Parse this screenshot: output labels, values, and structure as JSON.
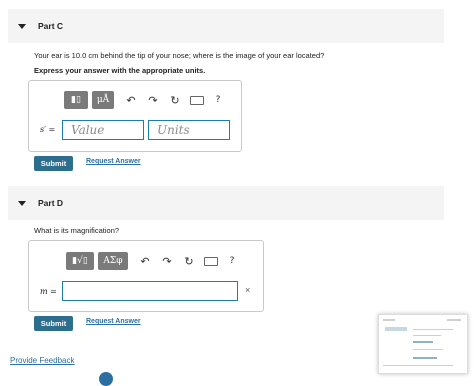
{
  "part_c": {
    "title": "Part C",
    "question": "Your ear is 10.0 cm behind the tip of your nose; where is the image of your ear located?",
    "instruction": "Express your answer with the appropriate units.",
    "toolbar": {
      "template_glyph": "▮▯",
      "units_glyph": "μÅ",
      "undo": "↶",
      "redo": "↷",
      "reset": "↻",
      "help": "?"
    },
    "variable": "s′ =",
    "value_placeholder": "Value",
    "units_placeholder": "Units",
    "submit_label": "Submit",
    "request_answer_label": "Request Answer"
  },
  "part_d": {
    "title": "Part D",
    "question": "What is its magnification?",
    "toolbar": {
      "template_glyph": "▮√▯",
      "greek_glyph": "ΑΣφ",
      "undo": "↶",
      "redo": "↷",
      "reset": "↻",
      "help": "?"
    },
    "variable": "m =",
    "clear": "×",
    "submit_label": "Submit",
    "request_answer_label": "Request Answer"
  },
  "feedback_label": "Provide Feedback",
  "colors": {
    "accent": "#2d6e8e",
    "link": "#2c6fa1",
    "field_border": "#1f7dae",
    "toolbar_group": "#7a7a7a"
  }
}
